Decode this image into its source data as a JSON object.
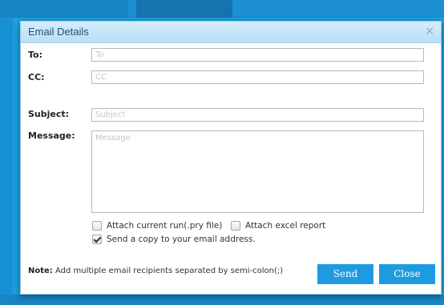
{
  "dialog": {
    "title": "Email Details",
    "close_icon": "×"
  },
  "form": {
    "to_label": "To:",
    "to_placeholder": "To",
    "cc_label": "CC:",
    "cc_placeholder": "CC",
    "subject_label": "Subject:",
    "subject_placeholder": "Subject",
    "message_label": "Message:",
    "message_placeholder": "Message"
  },
  "options": {
    "attach_run": {
      "label": "Attach current run(.pry file)",
      "checked": false
    },
    "attach_excel": {
      "label": "Attach excel report",
      "checked": false
    },
    "send_copy": {
      "label": "Send a copy to your email address.",
      "checked": true
    }
  },
  "footer": {
    "note_bold": "Note:",
    "note_text": " Add multiple email recipients separated by semi-colon(;)",
    "send_label": "Send",
    "close_label": "Close"
  },
  "colors": {
    "accent": "#1e9be0",
    "titlebar": "#c9e6f8",
    "background": "#1ba1e2"
  },
  "icons": [
    "close-icon",
    "checkbox-icon"
  ]
}
